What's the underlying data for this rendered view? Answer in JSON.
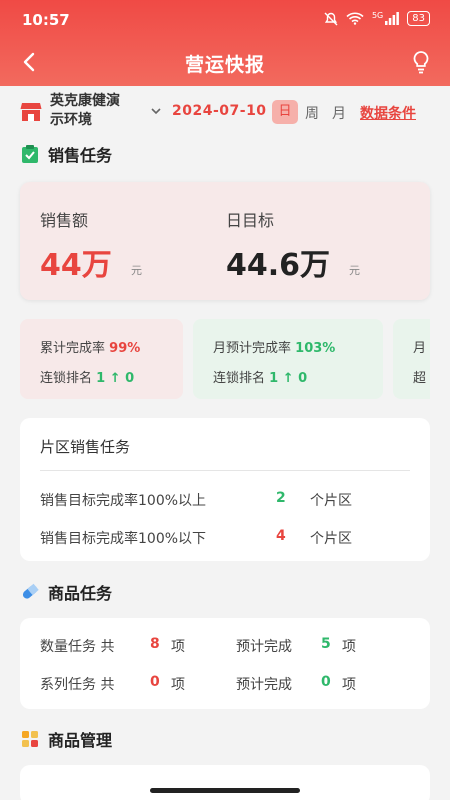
{
  "status": {
    "time": "10:57",
    "network": "5G",
    "battery": "83"
  },
  "header": {
    "title": "营运快报"
  },
  "filter": {
    "store_line1": "英克康健演",
    "store_line2": "示环境",
    "date": "2024-07-10",
    "tab_day": "日",
    "tab_week": "周",
    "tab_month": "月",
    "conditions": "数据条件"
  },
  "sales_section": {
    "title": "销售任务",
    "sales_label": "销售额",
    "sales_value": "44万",
    "sales_unit": "元",
    "target_label": "日目标",
    "target_value": "44.6万",
    "target_unit": "元"
  },
  "mini_cards": [
    {
      "line1_label": "累计完成率",
      "line1_value": "99%",
      "line2_label": "连锁排名",
      "line2_value": "1 ↑ 0"
    },
    {
      "line1_label": "月预计完成率",
      "line1_value": "103%",
      "line2_label": "连锁排名",
      "line2_value": "1 ↑ 0"
    },
    {
      "line1_label": "月",
      "line2_label": "超"
    }
  ],
  "region": {
    "title": "片区销售任务",
    "row1_text": "销售目标完成率100%以上",
    "row1_num": "2",
    "row1_unit": "个片区",
    "row2_text": "销售目标完成率100%以下",
    "row2_num": "4",
    "row2_unit": "个片区"
  },
  "goods_section": {
    "title": "商品任务",
    "qty_label": "数量任务 共",
    "qty_num": "8",
    "qty_unit": "项",
    "qty_est_label": "预计完成",
    "qty_est_num": "5",
    "qty_est_unit": "项",
    "series_label": "系列任务 共",
    "series_num": "0",
    "series_unit": "项",
    "series_est_label": "预计完成",
    "series_est_num": "0",
    "series_est_unit": "项"
  },
  "manage_section": {
    "title": "商品管理"
  },
  "colors": {
    "brand_red": "#e8453f",
    "green": "#2fb86b",
    "header_top": "#f04a45"
  }
}
